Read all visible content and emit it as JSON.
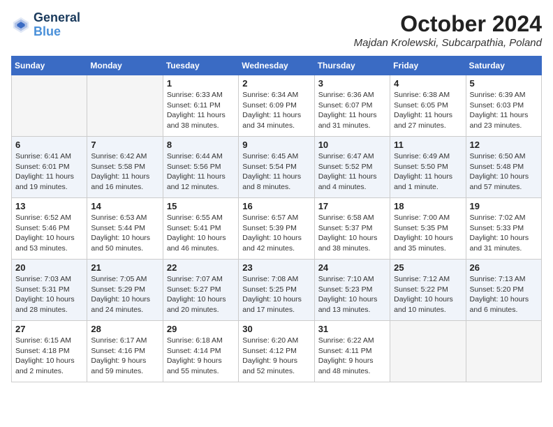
{
  "header": {
    "logo_line1": "General",
    "logo_line2": "Blue",
    "month": "October 2024",
    "location": "Majdan Krolewski, Subcarpathia, Poland"
  },
  "days_of_week": [
    "Sunday",
    "Monday",
    "Tuesday",
    "Wednesday",
    "Thursday",
    "Friday",
    "Saturday"
  ],
  "weeks": [
    [
      {
        "day": "",
        "info": ""
      },
      {
        "day": "",
        "info": ""
      },
      {
        "day": "1",
        "info": "Sunrise: 6:33 AM\nSunset: 6:11 PM\nDaylight: 11 hours and 38 minutes."
      },
      {
        "day": "2",
        "info": "Sunrise: 6:34 AM\nSunset: 6:09 PM\nDaylight: 11 hours and 34 minutes."
      },
      {
        "day": "3",
        "info": "Sunrise: 6:36 AM\nSunset: 6:07 PM\nDaylight: 11 hours and 31 minutes."
      },
      {
        "day": "4",
        "info": "Sunrise: 6:38 AM\nSunset: 6:05 PM\nDaylight: 11 hours and 27 minutes."
      },
      {
        "day": "5",
        "info": "Sunrise: 6:39 AM\nSunset: 6:03 PM\nDaylight: 11 hours and 23 minutes."
      }
    ],
    [
      {
        "day": "6",
        "info": "Sunrise: 6:41 AM\nSunset: 6:01 PM\nDaylight: 11 hours and 19 minutes."
      },
      {
        "day": "7",
        "info": "Sunrise: 6:42 AM\nSunset: 5:58 PM\nDaylight: 11 hours and 16 minutes."
      },
      {
        "day": "8",
        "info": "Sunrise: 6:44 AM\nSunset: 5:56 PM\nDaylight: 11 hours and 12 minutes."
      },
      {
        "day": "9",
        "info": "Sunrise: 6:45 AM\nSunset: 5:54 PM\nDaylight: 11 hours and 8 minutes."
      },
      {
        "day": "10",
        "info": "Sunrise: 6:47 AM\nSunset: 5:52 PM\nDaylight: 11 hours and 4 minutes."
      },
      {
        "day": "11",
        "info": "Sunrise: 6:49 AM\nSunset: 5:50 PM\nDaylight: 11 hours and 1 minute."
      },
      {
        "day": "12",
        "info": "Sunrise: 6:50 AM\nSunset: 5:48 PM\nDaylight: 10 hours and 57 minutes."
      }
    ],
    [
      {
        "day": "13",
        "info": "Sunrise: 6:52 AM\nSunset: 5:46 PM\nDaylight: 10 hours and 53 minutes."
      },
      {
        "day": "14",
        "info": "Sunrise: 6:53 AM\nSunset: 5:44 PM\nDaylight: 10 hours and 50 minutes."
      },
      {
        "day": "15",
        "info": "Sunrise: 6:55 AM\nSunset: 5:41 PM\nDaylight: 10 hours and 46 minutes."
      },
      {
        "day": "16",
        "info": "Sunrise: 6:57 AM\nSunset: 5:39 PM\nDaylight: 10 hours and 42 minutes."
      },
      {
        "day": "17",
        "info": "Sunrise: 6:58 AM\nSunset: 5:37 PM\nDaylight: 10 hours and 38 minutes."
      },
      {
        "day": "18",
        "info": "Sunrise: 7:00 AM\nSunset: 5:35 PM\nDaylight: 10 hours and 35 minutes."
      },
      {
        "day": "19",
        "info": "Sunrise: 7:02 AM\nSunset: 5:33 PM\nDaylight: 10 hours and 31 minutes."
      }
    ],
    [
      {
        "day": "20",
        "info": "Sunrise: 7:03 AM\nSunset: 5:31 PM\nDaylight: 10 hours and 28 minutes."
      },
      {
        "day": "21",
        "info": "Sunrise: 7:05 AM\nSunset: 5:29 PM\nDaylight: 10 hours and 24 minutes."
      },
      {
        "day": "22",
        "info": "Sunrise: 7:07 AM\nSunset: 5:27 PM\nDaylight: 10 hours and 20 minutes."
      },
      {
        "day": "23",
        "info": "Sunrise: 7:08 AM\nSunset: 5:25 PM\nDaylight: 10 hours and 17 minutes."
      },
      {
        "day": "24",
        "info": "Sunrise: 7:10 AM\nSunset: 5:23 PM\nDaylight: 10 hours and 13 minutes."
      },
      {
        "day": "25",
        "info": "Sunrise: 7:12 AM\nSunset: 5:22 PM\nDaylight: 10 hours and 10 minutes."
      },
      {
        "day": "26",
        "info": "Sunrise: 7:13 AM\nSunset: 5:20 PM\nDaylight: 10 hours and 6 minutes."
      }
    ],
    [
      {
        "day": "27",
        "info": "Sunrise: 6:15 AM\nSunset: 4:18 PM\nDaylight: 10 hours and 2 minutes."
      },
      {
        "day": "28",
        "info": "Sunrise: 6:17 AM\nSunset: 4:16 PM\nDaylight: 9 hours and 59 minutes."
      },
      {
        "day": "29",
        "info": "Sunrise: 6:18 AM\nSunset: 4:14 PM\nDaylight: 9 hours and 55 minutes."
      },
      {
        "day": "30",
        "info": "Sunrise: 6:20 AM\nSunset: 4:12 PM\nDaylight: 9 hours and 52 minutes."
      },
      {
        "day": "31",
        "info": "Sunrise: 6:22 AM\nSunset: 4:11 PM\nDaylight: 9 hours and 48 minutes."
      },
      {
        "day": "",
        "info": ""
      },
      {
        "day": "",
        "info": ""
      }
    ]
  ]
}
